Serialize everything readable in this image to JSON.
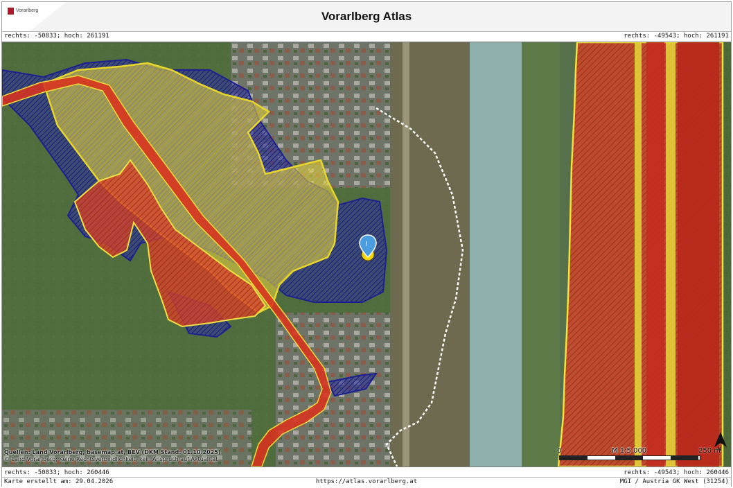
{
  "header": {
    "title": "Vorarlberg Atlas",
    "logo_text": "Vorarlberg"
  },
  "coords": {
    "top_left": "rechts: -50833; hoch: 261191",
    "top_right": "rechts: -49543; hoch: 261191",
    "bottom_left": "rechts: -50833; hoch: 260446",
    "bottom_right": "rechts: -49543; hoch: 260446"
  },
  "map": {
    "sources_line1": "Quellen: Land Vorarlberg, basemap.at, BEV (DKM Stand: 01.10.2025)",
    "sources_line2": "© Land Vorarlberg; Keine Rechtsverbindlichkeit, kein Anspruch auf Aktualität",
    "scale_label": "M 1:5 000",
    "scale_start": "0",
    "scale_end": "250 m",
    "north_icon": "north-arrow-icon",
    "marker_icon": "location-pin-icon",
    "layer_colors": {
      "yellow_zone": "#e9d83a",
      "red_zone": "#d8422a",
      "blue_zone": "#2a2f9e",
      "river": "#8fb4b0"
    }
  },
  "footer": {
    "created": "Karte erstellt am: 29.04.2026",
    "url": "https://atlas.vorarlberg.at",
    "crs": "MGI / Austria GK West (31254)"
  }
}
